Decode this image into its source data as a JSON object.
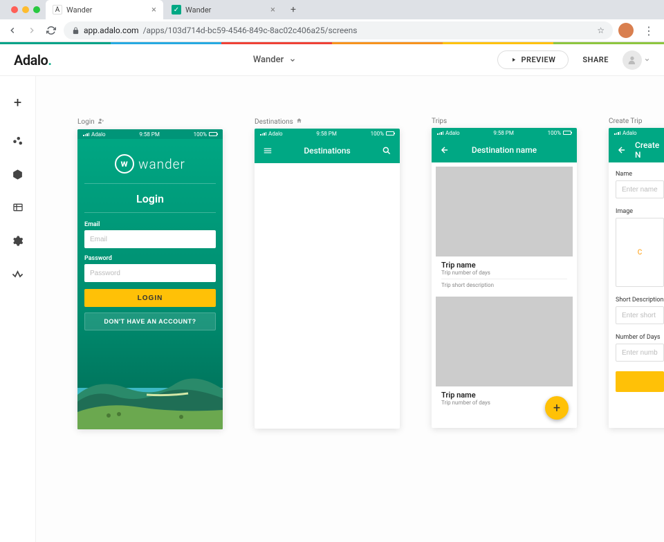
{
  "browser": {
    "tabs": [
      {
        "title": "Wander",
        "favicon": "A"
      },
      {
        "title": "Wander",
        "favicon": "teal"
      }
    ],
    "url_host": "app.adalo.com",
    "url_path": "/apps/103d714d-bc59-4546-849c-8ac02c406a25/screens"
  },
  "header": {
    "logo_text": "Adalo",
    "project_name": "Wander",
    "preview_label": "PREVIEW",
    "share_label": "SHARE"
  },
  "status_bar": {
    "carrier": "Adalo",
    "time": "9:58 PM",
    "battery": "100%"
  },
  "screens": {
    "login": {
      "label": "Login",
      "brand": "wander",
      "title": "Login",
      "email_label": "Email",
      "email_placeholder": "Email",
      "password_label": "Password",
      "password_placeholder": "Password",
      "button": "LOGIN",
      "signup_link": "DON'T HAVE AN ACCOUNT?"
    },
    "destinations": {
      "label": "Destinations",
      "title": "Destinations"
    },
    "trips": {
      "label": "Trips",
      "title": "Destination name",
      "card1": {
        "name": "Trip name",
        "days": "Trip number of days",
        "desc": "Trip short description"
      },
      "card2": {
        "name": "Trip name",
        "days": "Trip number of days"
      }
    },
    "create_trip": {
      "label": "Create Trip",
      "title": "Create N",
      "name_label": "Name",
      "name_placeholder": "Enter name...",
      "image_label": "Image",
      "image_cta": "C",
      "short_desc_label": "Short Description",
      "short_desc_placeholder": "Enter short descr",
      "days_label": "Number of Days",
      "days_placeholder": "Enter number of d"
    }
  }
}
